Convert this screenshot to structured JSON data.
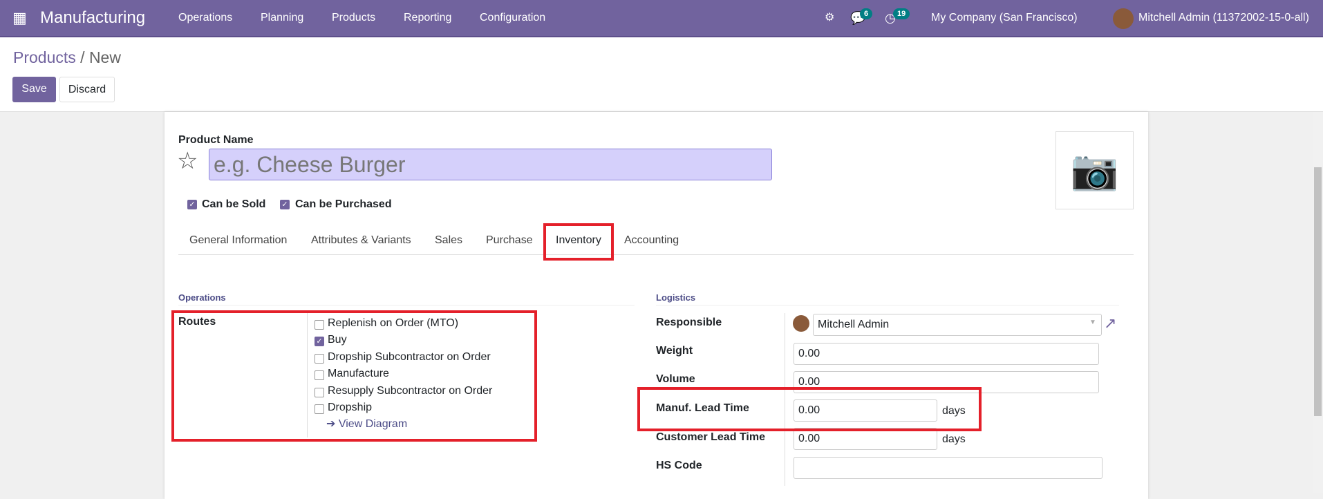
{
  "navbar": {
    "app": "Manufacturing",
    "menus": [
      "Operations",
      "Planning",
      "Products",
      "Reporting",
      "Configuration"
    ],
    "messages_count": "6",
    "activities_count": "19",
    "company": "My Company (San Francisco)",
    "user": "Mitchell Admin (11372002-15-0-all)"
  },
  "breadcrumb": {
    "parent": "Products",
    "current": "New"
  },
  "buttons": {
    "save": "Save",
    "discard": "Discard"
  },
  "form": {
    "product_name_label": "Product Name",
    "product_name_placeholder": "e.g. Cheese Burger",
    "can_be_sold": "Can be Sold",
    "can_be_purchased": "Can be Purchased",
    "tabs": [
      "General Information",
      "Attributes & Variants",
      "Sales",
      "Purchase",
      "Inventory",
      "Accounting"
    ],
    "active_tab": "Inventory",
    "operations": {
      "title": "Operations",
      "routes_label": "Routes",
      "routes": [
        {
          "label": "Replenish on Order (MTO)",
          "checked": false
        },
        {
          "label": "Buy",
          "checked": true
        },
        {
          "label": "Dropship Subcontractor on Order",
          "checked": false
        },
        {
          "label": "Manufacture",
          "checked": false
        },
        {
          "label": "Resupply Subcontractor on Order",
          "checked": false
        },
        {
          "label": "Dropship",
          "checked": false
        }
      ],
      "view_diagram": "View Diagram"
    },
    "logistics": {
      "title": "Logistics",
      "responsible_label": "Responsible",
      "responsible": "Mitchell Admin",
      "weight_label": "Weight",
      "weight": "0.00",
      "volume_label": "Volume",
      "volume": "0.00",
      "manuf_lead_label": "Manuf. Lead Time",
      "manuf_lead": "0.00",
      "customer_lead_label": "Customer Lead Time",
      "customer_lead": "0.00",
      "days": "days",
      "hs_code_label": "HS Code",
      "hs_code": ""
    }
  },
  "colors": {
    "brand": "#71639e",
    "highlight": "#e4202a",
    "badge": "#017e84"
  }
}
